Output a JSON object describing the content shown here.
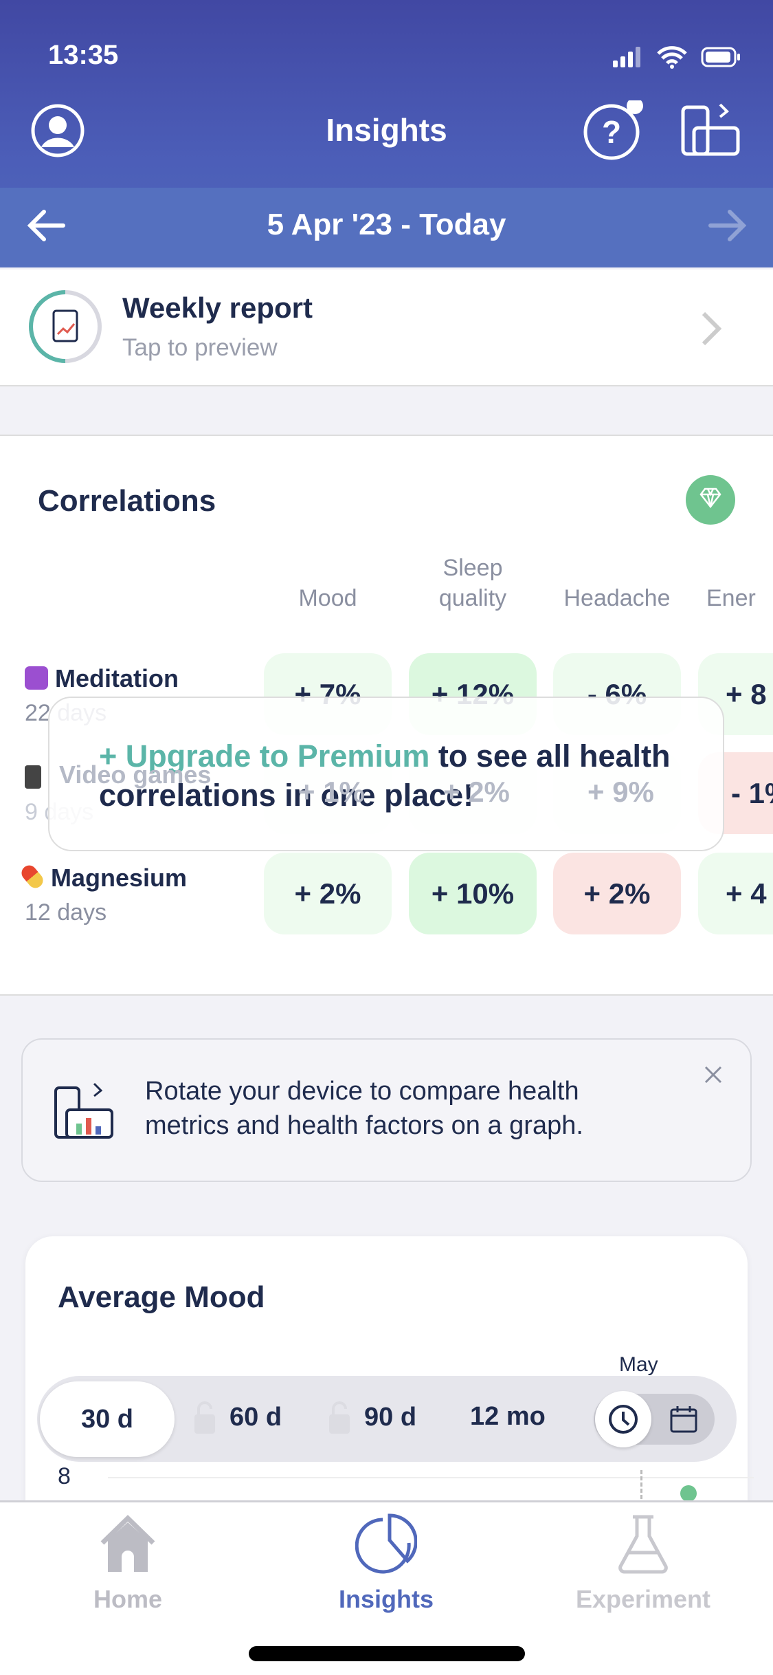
{
  "status_bar": {
    "time": "13:35"
  },
  "header": {
    "title": "Insights",
    "date_range": "5 Apr '23 - Today"
  },
  "weekly_report": {
    "title": "Weekly report",
    "subtitle": "Tap to preview"
  },
  "correlations": {
    "title": "Correlations",
    "columns": [
      {
        "line1": "",
        "line2": "Mood"
      },
      {
        "line1": "Sleep",
        "line2": "quality"
      },
      {
        "line1": "",
        "line2": "Headache"
      },
      {
        "line1": "",
        "line2": "Ener"
      }
    ],
    "rows": [
      {
        "label": "Meditation",
        "days": "22 days",
        "values": [
          "+ 7%",
          "+ 12%",
          "- 6%",
          "+ 8"
        ]
      },
      {
        "label": "Video games",
        "days": "9 days",
        "values": [
          "+ 1%",
          "+ 2%",
          "+ 9%",
          "- 1%"
        ]
      },
      {
        "label": "Magnesium",
        "days": "12 days",
        "values": [
          "+ 2%",
          "+ 10%",
          "+ 2%",
          "+ 4"
        ]
      }
    ],
    "upgrade": {
      "link": "+ Upgrade to Premium",
      "text": " to see all health correlations in one place!"
    }
  },
  "rotate_banner": {
    "text": "Rotate your device to compare health metrics and health factors on a graph."
  },
  "average_mood": {
    "title": "Average Mood",
    "month_label": "May",
    "y_tick": "8",
    "ranges": [
      {
        "label": "30 d",
        "locked": false,
        "selected": true
      },
      {
        "label": "60 d",
        "locked": true
      },
      {
        "label": "90 d",
        "locked": true
      },
      {
        "label": "12 mo",
        "locked": false
      }
    ]
  },
  "tabs": [
    {
      "label": "Home",
      "active": false
    },
    {
      "label": "Insights",
      "active": true
    },
    {
      "label": "Experiment",
      "active": false
    }
  ],
  "colors": {
    "accent": "#5068bb",
    "premium": "#5bb5a8",
    "positive": "#dcf8df",
    "negative": "#fbe4e2",
    "text": "#1f2b4d"
  }
}
